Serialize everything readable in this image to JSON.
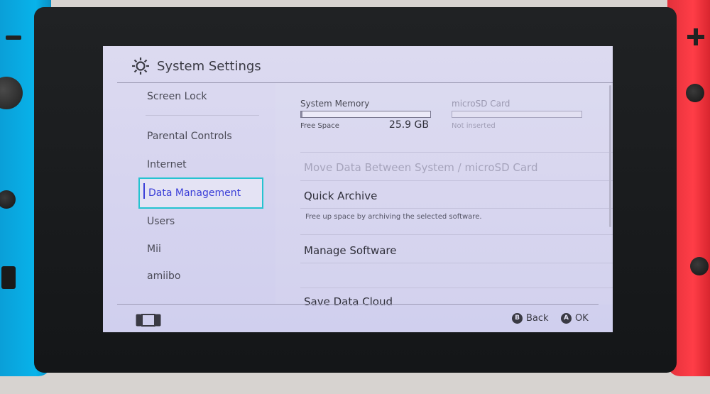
{
  "header": {
    "title": "System Settings",
    "icon": "gear-icon"
  },
  "sidebar": {
    "items": [
      {
        "label": "Screen Lock"
      },
      {
        "label": "Parental Controls"
      },
      {
        "label": "Internet"
      },
      {
        "label": "Data Management",
        "selected": true
      },
      {
        "label": "Users"
      },
      {
        "label": "Mii"
      },
      {
        "label": "amiibo"
      }
    ]
  },
  "storage": {
    "system": {
      "title": "System Memory",
      "free_label": "Free Space",
      "free_value": "25.9 GB",
      "used_fraction": 0.01
    },
    "sd": {
      "title": "microSD Card",
      "status": "Not inserted"
    }
  },
  "content": {
    "move_data": "Move Data Between System / microSD Card",
    "quick_archive": "Quick Archive",
    "quick_archive_desc": "Free up space by archiving the selected software.",
    "manage_software": "Manage Software",
    "save_data_cloud": "Save Data Cloud"
  },
  "footer": {
    "back": {
      "button": "B",
      "label": "Back"
    },
    "ok": {
      "button": "A",
      "label": "OK"
    }
  },
  "colors": {
    "selection_border": "#25c3d0",
    "selection_text": "#3b3fd8",
    "joycon_left": "#08b3ea",
    "joycon_right": "#ff3d47"
  }
}
